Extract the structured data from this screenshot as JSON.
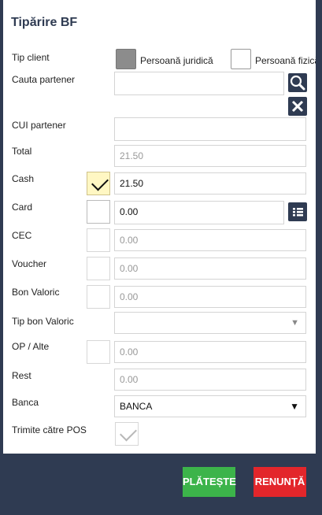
{
  "dialog": {
    "title": "Tipărire BF"
  },
  "tip_client": {
    "label": "Tip client",
    "options": [
      {
        "label": "Persoană juridică",
        "selected": true
      },
      {
        "label": "Persoană fizică",
        "selected": false
      }
    ]
  },
  "cauta_partener": {
    "label": "Cauta partener",
    "value": ""
  },
  "cui_partener": {
    "label": "CUI partener",
    "value": ""
  },
  "total": {
    "label": "Total",
    "value": "21.50"
  },
  "cash": {
    "label": "Cash",
    "value": "21.50",
    "checked": true
  },
  "card": {
    "label": "Card",
    "value": "0.00",
    "checked": false
  },
  "cec": {
    "label": "CEC",
    "value": "0.00",
    "checked": false
  },
  "voucher": {
    "label": "Voucher",
    "value": "0.00",
    "checked": false
  },
  "bon_valoric": {
    "label": "Bon Valoric",
    "value": "0.00",
    "checked": false
  },
  "tip_bon_valoric": {
    "label": "Tip bon Valoric",
    "value": ""
  },
  "op_alte": {
    "label": "OP / Alte",
    "value": "0.00",
    "checked": false
  },
  "rest": {
    "label": "Rest",
    "value": "0.00"
  },
  "banca": {
    "label": "Banca",
    "value": "BANCA"
  },
  "trimite_pos": {
    "label": "Trimite către POS",
    "checked": true
  },
  "footer": {
    "plateste_label": "PLĂTEȘTE",
    "renunta_label": "RENUNȚĂ"
  },
  "colors": {
    "header_bg": "#2f3b52",
    "pay_btn": "#3cb44a",
    "cancel_btn": "#e3262b",
    "cash_checkbox": "#fff7c3"
  },
  "icons": [
    "search-icon",
    "close-icon",
    "list-icon",
    "dropdown-arrow-icon",
    "checkmark-icon"
  ]
}
